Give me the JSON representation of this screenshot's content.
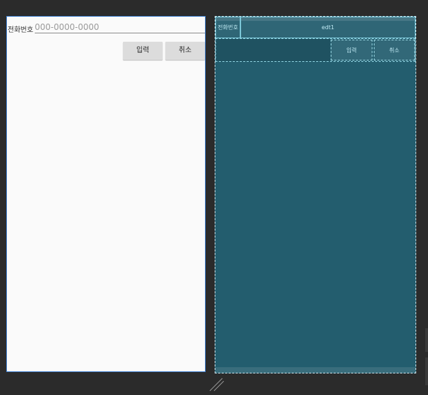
{
  "design": {
    "phone_label": "전화번호",
    "phone_placeholder": "000-0000-0000",
    "ok_button": "입력",
    "cancel_button": "취소"
  },
  "blueprint": {
    "phone_label": "전화번호",
    "edit_id": "edt1",
    "ok_button": "입력",
    "cancel_button": "취소"
  },
  "colors": {
    "canvas": "#2b2b2b",
    "design_bg": "#fafafa",
    "blueprint_bg": "#235d6e",
    "selection_border": "#3d7ecf"
  }
}
